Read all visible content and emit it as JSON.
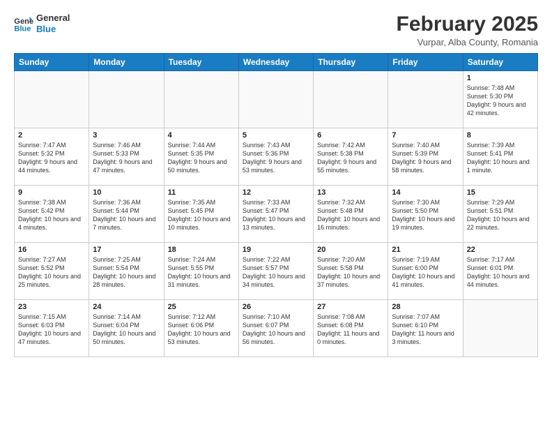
{
  "header": {
    "logo_line1": "General",
    "logo_line2": "Blue",
    "title": "February 2025",
    "subtitle": "Vurpar, Alba County, Romania"
  },
  "weekdays": [
    "Sunday",
    "Monday",
    "Tuesday",
    "Wednesday",
    "Thursday",
    "Friday",
    "Saturday"
  ],
  "weeks": [
    [
      {
        "day": "",
        "info": ""
      },
      {
        "day": "",
        "info": ""
      },
      {
        "day": "",
        "info": ""
      },
      {
        "day": "",
        "info": ""
      },
      {
        "day": "",
        "info": ""
      },
      {
        "day": "",
        "info": ""
      },
      {
        "day": "1",
        "info": "Sunrise: 7:48 AM\nSunset: 5:30 PM\nDaylight: 9 hours and 42 minutes."
      }
    ],
    [
      {
        "day": "2",
        "info": "Sunrise: 7:47 AM\nSunset: 5:32 PM\nDaylight: 9 hours and 44 minutes."
      },
      {
        "day": "3",
        "info": "Sunrise: 7:46 AM\nSunset: 5:33 PM\nDaylight: 9 hours and 47 minutes."
      },
      {
        "day": "4",
        "info": "Sunrise: 7:44 AM\nSunset: 5:35 PM\nDaylight: 9 hours and 50 minutes."
      },
      {
        "day": "5",
        "info": "Sunrise: 7:43 AM\nSunset: 5:36 PM\nDaylight: 9 hours and 53 minutes."
      },
      {
        "day": "6",
        "info": "Sunrise: 7:42 AM\nSunset: 5:38 PM\nDaylight: 9 hours and 55 minutes."
      },
      {
        "day": "7",
        "info": "Sunrise: 7:40 AM\nSunset: 5:39 PM\nDaylight: 9 hours and 58 minutes."
      },
      {
        "day": "8",
        "info": "Sunrise: 7:39 AM\nSunset: 5:41 PM\nDaylight: 10 hours and 1 minute."
      }
    ],
    [
      {
        "day": "9",
        "info": "Sunrise: 7:38 AM\nSunset: 5:42 PM\nDaylight: 10 hours and 4 minutes."
      },
      {
        "day": "10",
        "info": "Sunrise: 7:36 AM\nSunset: 5:44 PM\nDaylight: 10 hours and 7 minutes."
      },
      {
        "day": "11",
        "info": "Sunrise: 7:35 AM\nSunset: 5:45 PM\nDaylight: 10 hours and 10 minutes."
      },
      {
        "day": "12",
        "info": "Sunrise: 7:33 AM\nSunset: 5:47 PM\nDaylight: 10 hours and 13 minutes."
      },
      {
        "day": "13",
        "info": "Sunrise: 7:32 AM\nSunset: 5:48 PM\nDaylight: 10 hours and 16 minutes."
      },
      {
        "day": "14",
        "info": "Sunrise: 7:30 AM\nSunset: 5:50 PM\nDaylight: 10 hours and 19 minutes."
      },
      {
        "day": "15",
        "info": "Sunrise: 7:29 AM\nSunset: 5:51 PM\nDaylight: 10 hours and 22 minutes."
      }
    ],
    [
      {
        "day": "16",
        "info": "Sunrise: 7:27 AM\nSunset: 5:52 PM\nDaylight: 10 hours and 25 minutes."
      },
      {
        "day": "17",
        "info": "Sunrise: 7:25 AM\nSunset: 5:54 PM\nDaylight: 10 hours and 28 minutes."
      },
      {
        "day": "18",
        "info": "Sunrise: 7:24 AM\nSunset: 5:55 PM\nDaylight: 10 hours and 31 minutes."
      },
      {
        "day": "19",
        "info": "Sunrise: 7:22 AM\nSunset: 5:57 PM\nDaylight: 10 hours and 34 minutes."
      },
      {
        "day": "20",
        "info": "Sunrise: 7:20 AM\nSunset: 5:58 PM\nDaylight: 10 hours and 37 minutes."
      },
      {
        "day": "21",
        "info": "Sunrise: 7:19 AM\nSunset: 6:00 PM\nDaylight: 10 hours and 41 minutes."
      },
      {
        "day": "22",
        "info": "Sunrise: 7:17 AM\nSunset: 6:01 PM\nDaylight: 10 hours and 44 minutes."
      }
    ],
    [
      {
        "day": "23",
        "info": "Sunrise: 7:15 AM\nSunset: 6:03 PM\nDaylight: 10 hours and 47 minutes."
      },
      {
        "day": "24",
        "info": "Sunrise: 7:14 AM\nSunset: 6:04 PM\nDaylight: 10 hours and 50 minutes."
      },
      {
        "day": "25",
        "info": "Sunrise: 7:12 AM\nSunset: 6:06 PM\nDaylight: 10 hours and 53 minutes."
      },
      {
        "day": "26",
        "info": "Sunrise: 7:10 AM\nSunset: 6:07 PM\nDaylight: 10 hours and 56 minutes."
      },
      {
        "day": "27",
        "info": "Sunrise: 7:08 AM\nSunset: 6:08 PM\nDaylight: 11 hours and 0 minutes."
      },
      {
        "day": "28",
        "info": "Sunrise: 7:07 AM\nSunset: 6:10 PM\nDaylight: 11 hours and 3 minutes."
      },
      {
        "day": "",
        "info": ""
      }
    ]
  ]
}
